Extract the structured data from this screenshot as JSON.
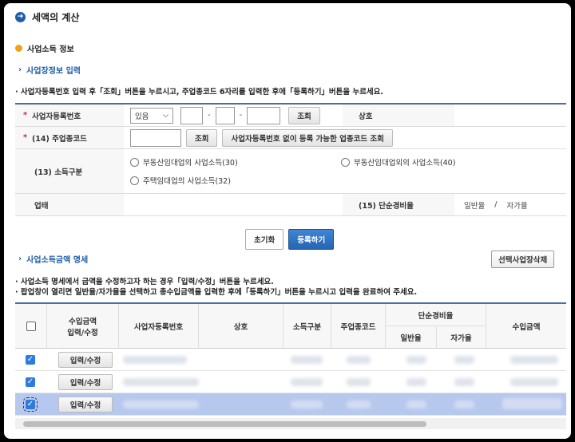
{
  "page": {
    "title": "세액의 계산"
  },
  "section": {
    "title": "사업소득 정보"
  },
  "business_info": {
    "subtitle": "사업장정보 입력",
    "note": "· 사업자등록번호 입력 후「조회」버튼을 누르시고, 주업종코드 6자리를 입력한 후에「등록하기」버튼을 누르세요."
  },
  "form": {
    "reg_no_label": "사업자등록번호",
    "reg_no_select": "있음",
    "lookup_btn": "조회",
    "company_label": "상호",
    "code_label": "(14) 주업종코드",
    "code_lookup_btn": "조회",
    "code_no_reg_btn": "사업자등록번호 없이 등록 가능한 업종코드 조회",
    "income_type_label": "(13) 소득구분",
    "income_type_opts": [
      "부동산임대업의 사업소득(30)",
      "부동산임대업외의 사업소득(40)",
      "주택임대업의 사업소득(32)"
    ],
    "biz_type_label": "업태",
    "simple_rate_label": "(15) 단순경비율",
    "rate_general": "일반율",
    "rate_sep": "/",
    "rate_self": "자가율",
    "required_mark": "*"
  },
  "actions": {
    "reset": "초기화",
    "register": "등록하기"
  },
  "income_detail": {
    "subtitle": "사업소득금액 명세",
    "delete_btn": "선택사업장삭제",
    "note1": "· 사업소득 명세에서 금액을 수정하고자 하는 경우「입력/수정」버튼을 누르세요.",
    "note2": "· 팝업창이 열리면 일반율/자가율을 선택하고 총수입금액을 입력한 후에「등록하기」버튼을 누르시고 입력을 완료하여 주세요."
  },
  "grid": {
    "headers": {
      "income": "수입금액\n입력/수정",
      "reg_no": "사업자등록번호",
      "company": "상호",
      "income_type": "소득구분",
      "main_code": "주업종코드",
      "simple_rate": "단순경비율",
      "general": "일반율",
      "self": "자가율",
      "revenue": "수입금액"
    },
    "rows": [
      {
        "checked": true,
        "edit_btn": "입력/수정"
      },
      {
        "checked": true,
        "edit_btn": "입력/수정"
      },
      {
        "checked": true,
        "edit_btn": "입력/수정"
      }
    ]
  }
}
